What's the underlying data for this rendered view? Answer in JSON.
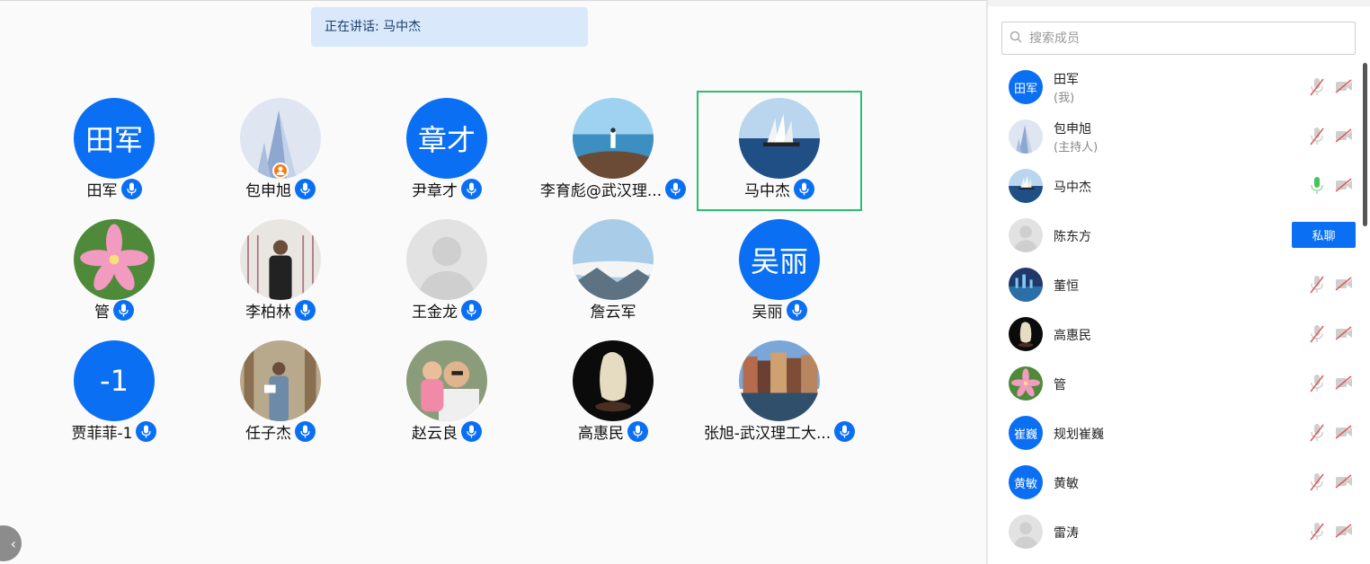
{
  "banner": {
    "speaking": "正在讲话: 马中杰"
  },
  "grid": [
    {
      "name": "田军",
      "avatar_text": "田军",
      "avatar": "text"
    },
    {
      "name": "包申旭",
      "avatar": "building",
      "host": true
    },
    {
      "name": "尹章才",
      "avatar_text": "章才",
      "avatar": "text"
    },
    {
      "name": "李育彪@武汉理...",
      "avatar": "sea-rock"
    },
    {
      "name": "马中杰",
      "avatar": "ship",
      "active": true
    },
    {
      "name": "管",
      "avatar": "flower"
    },
    {
      "name": "李柏林",
      "avatar": "man-gate"
    },
    {
      "name": "王金龙",
      "avatar": "default"
    },
    {
      "name": "詹云军",
      "avatar": "mountain",
      "no_mic": true
    },
    {
      "name": "吴丽",
      "avatar_text": "吴丽",
      "avatar": "text"
    },
    {
      "name": "贾菲菲-1",
      "avatar_text": "-1",
      "avatar": "text"
    },
    {
      "name": "任子杰",
      "avatar": "library"
    },
    {
      "name": "赵云良",
      "avatar": "father-child"
    },
    {
      "name": "高惠民",
      "avatar": "stone"
    },
    {
      "name": "张旭-武汉理工大...",
      "avatar": "canal"
    }
  ],
  "sidebar": {
    "search_placeholder": "搜索成员",
    "dm_label": "私聊",
    "members": [
      {
        "name": "田军",
        "role": "(我)",
        "avatar": "text",
        "avatar_text": "田军",
        "mic": "muted"
      },
      {
        "name": "包申旭",
        "role": "(主持人)",
        "avatar": "building",
        "mic": "muted"
      },
      {
        "name": "马中杰",
        "avatar": "ship",
        "mic": "active"
      },
      {
        "name": "陈东方",
        "avatar": "default",
        "mic": "none",
        "dm": true
      },
      {
        "name": "董恒",
        "avatar": "night-city",
        "mic": "muted"
      },
      {
        "name": "高惠民",
        "avatar": "stone",
        "mic": "muted"
      },
      {
        "name": "管",
        "avatar": "flower",
        "mic": "muted"
      },
      {
        "name": "规划崔巍",
        "avatar": "text",
        "avatar_text": "崔巍",
        "mic": "muted"
      },
      {
        "name": "黄敏",
        "avatar": "text",
        "avatar_text": "黄敏",
        "mic": "muted"
      },
      {
        "name": "雷涛",
        "avatar": "default",
        "mic": "muted"
      }
    ]
  },
  "icons": {
    "mic_badge": "mic-icon",
    "host_badge": "host-icon",
    "search": "search-icon",
    "muted_mic": "mic-off-icon",
    "cam_off": "camera-off-icon",
    "collapse": "chevron-left-icon"
  },
  "colors": {
    "accent": "#0a6ff2",
    "active_border": "#2dbd6e",
    "muted": "#e05a5a",
    "banner": "#d9e9fb"
  }
}
